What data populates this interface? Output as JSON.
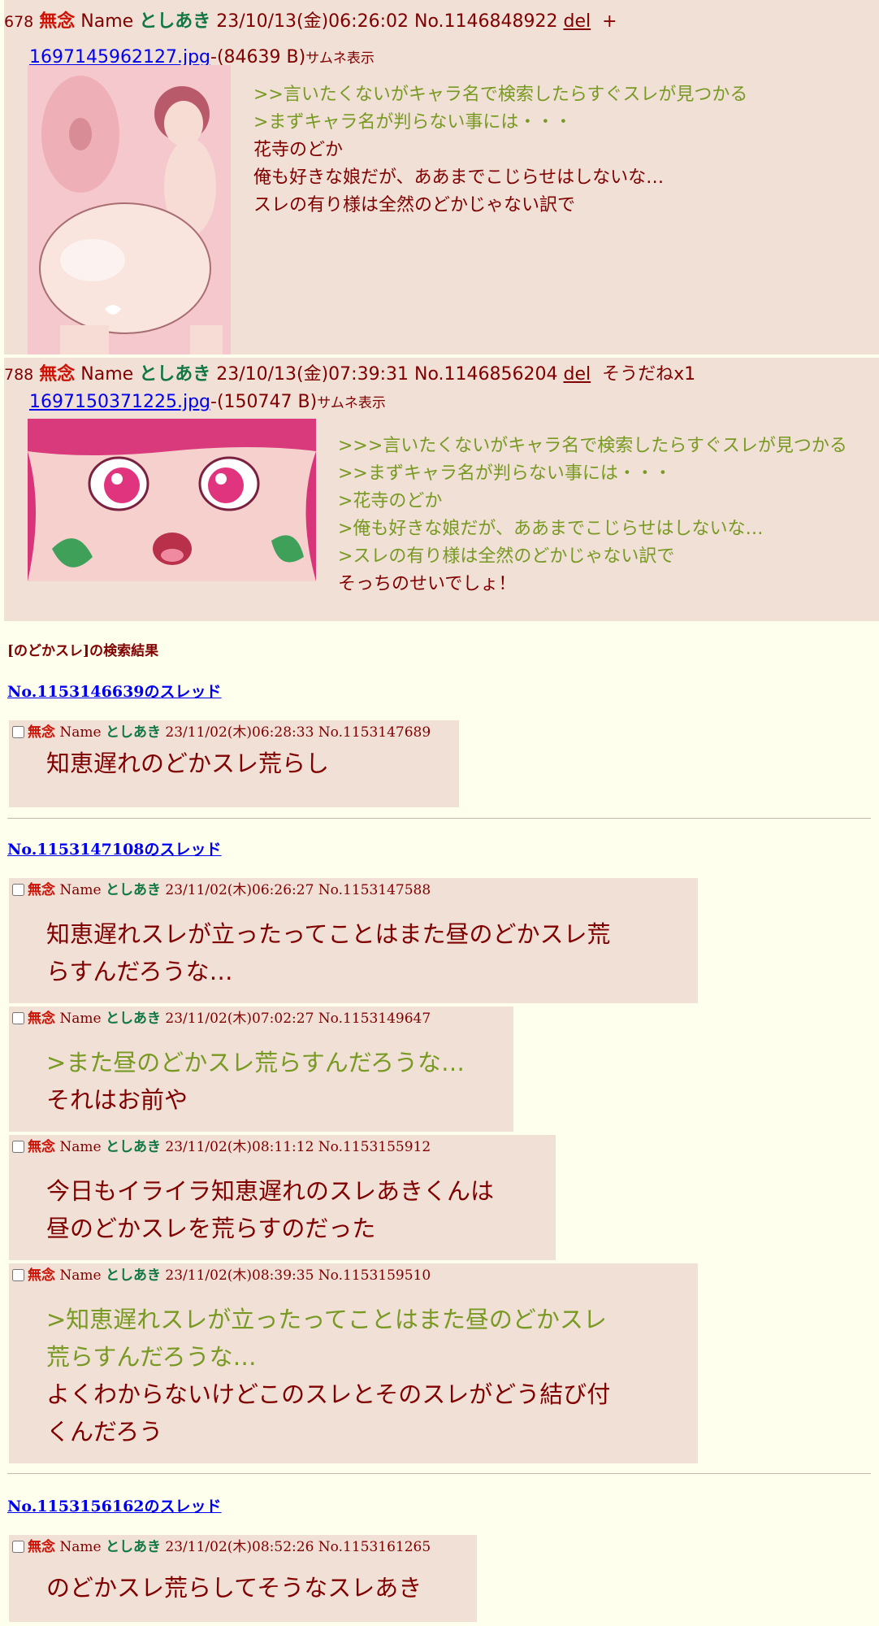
{
  "post1": {
    "num": "678",
    "subject": "無念",
    "name_label": "Name",
    "name": "としあき",
    "datetime": "23/10/13(金)06:26:02",
    "no": "No.1146848922",
    "del": "del",
    "extra": "+",
    "file_name": "1697145962127.jpg",
    "file_size": "-(84639 B)",
    "thumb_label": "サムネ表示",
    "lines": [
      ">>言いたくないがキャラ名で検索したらすぐスレが見つかる",
      ">まずキャラ名が判らない事には・・・",
      "花寺のどか",
      "俺も好きな娘だが、ああまでこじらせはしないな…",
      "スレの有り様は全然のどかじゃない訳で"
    ]
  },
  "post2": {
    "num": "788",
    "subject": "無念",
    "name_label": "Name",
    "name": "としあき",
    "datetime": "23/10/13(金)07:39:31",
    "no": "No.1146856204",
    "del": "del",
    "extra": "そうだねx1",
    "file_name": "1697150371225.jpg",
    "file_size": "-(150747 B)",
    "thumb_label": "サムネ表示",
    "lines": [
      ">>>言いたくないがキャラ名で検索したらすぐスレが見つかる",
      ">>まずキャラ名が判らない事には・・・",
      ">花寺のどか",
      ">俺も好きな娘だが、ああまでこじらせはしないな…",
      ">スレの有り様は全然のどかじゃない訳で",
      "そっちのせいでしょ！"
    ]
  },
  "search": {
    "title": "[のどかスレ]の検索結果",
    "threads": [
      {
        "link": "No.1153146639のスレッド",
        "responses": [
          {
            "subject": "無念",
            "name_label": "Name",
            "name": "としあき",
            "datetime": "23/11/02(木)06:28:33",
            "no": "No.1153147689",
            "lines": [
              "知恵遅れのどかスレ荒らし"
            ]
          }
        ]
      },
      {
        "link": "No.1153147108のスレッド",
        "responses": [
          {
            "subject": "無念",
            "name_label": "Name",
            "name": "としあき",
            "datetime": "23/11/02(木)06:26:27",
            "no": "No.1153147588",
            "lines": [
              "知恵遅れスレが立ったってことはまた昼のどかスレ荒",
              "らすんだろうな…"
            ]
          },
          {
            "subject": "無念",
            "name_label": "Name",
            "name": "としあき",
            "datetime": "23/11/02(木)07:02:27",
            "no": "No.1153149647",
            "lines": [
              ">また昼のどかスレ荒らすんだろうな…",
              "それはお前や"
            ]
          },
          {
            "subject": "無念",
            "name_label": "Name",
            "name": "としあき",
            "datetime": "23/11/02(木)08:11:12",
            "no": "No.1153155912",
            "lines": [
              "今日もイライラ知恵遅れのスレあきくんは",
              "昼のどかスレを荒らすのだった"
            ]
          },
          {
            "subject": "無念",
            "name_label": "Name",
            "name": "としあき",
            "datetime": "23/11/02(木)08:39:35",
            "no": "No.1153159510",
            "lines": [
              ">知恵遅れスレが立ったってことはまた昼のどかスレ",
              "荒らすんだろうな…",
              "よくわからないけどこのスレとそのスレがどう結び付",
              "くんだろう"
            ]
          }
        ]
      },
      {
        "link": "No.1153156162のスレッド",
        "responses": [
          {
            "subject": "無念",
            "name_label": "Name",
            "name": "としあき",
            "datetime": "23/11/02(木)08:52:26",
            "no": "No.1153161265",
            "lines": [
              "のどかスレ荒らしてそうなスレあき"
            ]
          }
        ]
      }
    ]
  }
}
